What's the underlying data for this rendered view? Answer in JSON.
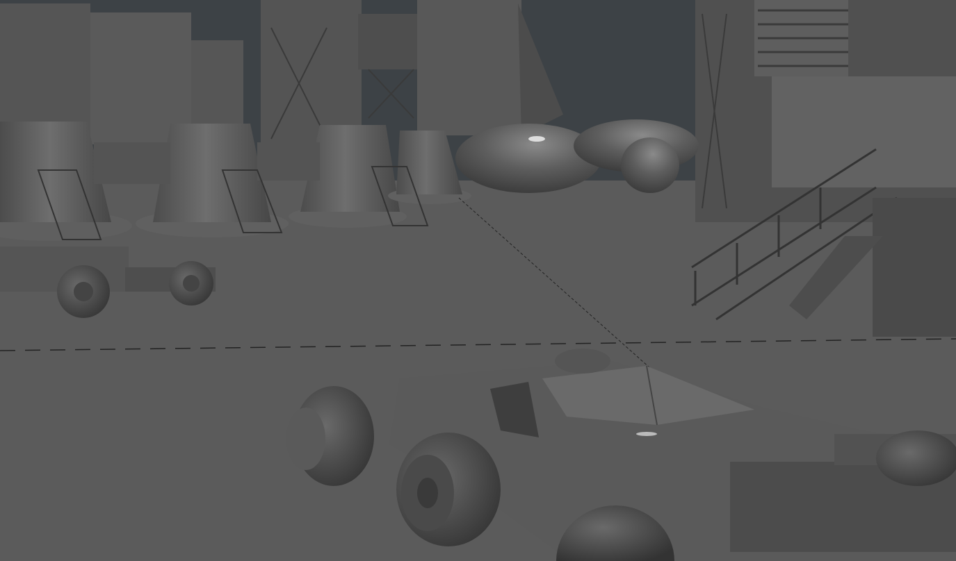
{
  "viewport": {
    "kind": "3d-viewport-shaded",
    "colors": {
      "sky": "#3d4246",
      "ground": "#5b5b5b",
      "building_dark": "#4a4a4a",
      "building_mid": "#5e5e5e",
      "building_light": "#6c6c6c",
      "vehicle": "#5a5a5a",
      "vehicle_dark": "#3e3e3e",
      "highlight": "#9a9a9a",
      "guide_line": "#222222"
    },
    "text": []
  }
}
